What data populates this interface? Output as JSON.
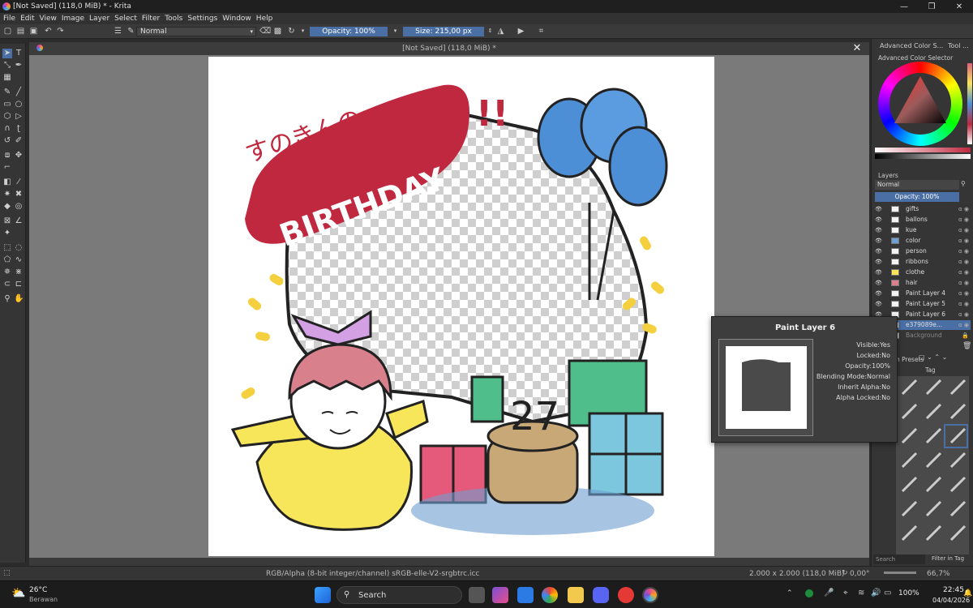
{
  "window": {
    "title": "[Not Saved]  (118,0 MiB) * - Krita",
    "minimize": "—",
    "maximize": "❐",
    "close": "✕"
  },
  "menu": [
    "File",
    "Edit",
    "View",
    "Image",
    "Layer",
    "Select",
    "Filter",
    "Tools",
    "Settings",
    "Window",
    "Help"
  ],
  "toolbar": {
    "blend_mode": "Normal",
    "opacity_label": "Opacity: 100%",
    "size_label": "Size: 215,00 px"
  },
  "document": {
    "tab_title": "[Not Saved]  (118,0 MiB) *",
    "close_glyph": "✕"
  },
  "artwork": {
    "text_top": "すのきんの",
    "text_banner": "BIRTHDAY",
    "exclaim": "!!",
    "cake_number": "27"
  },
  "docker": {
    "tab1": "Advanced Color S...",
    "tab2": "Tool ...",
    "color_selector_title": "Advanced Color Selector",
    "layers_title": "Layers",
    "blend_mode": "Normal",
    "opacity": "Opacity: 100%",
    "layers": [
      {
        "name": "gifts"
      },
      {
        "name": "ballons"
      },
      {
        "name": "kue"
      },
      {
        "name": "color"
      },
      {
        "name": "person"
      },
      {
        "name": "ribbons"
      },
      {
        "name": "clothe"
      },
      {
        "name": "hair"
      },
      {
        "name": "Paint Layer 4"
      },
      {
        "name": "Paint Layer 5"
      },
      {
        "name": "Paint Layer 6"
      },
      {
        "name": "e379089e..."
      },
      {
        "name": "Background"
      }
    ],
    "brush_presets_title": "h Presets",
    "tag_label": "Tag",
    "search_placeholder": "Search",
    "filter_in_tag": "Filter in Tag"
  },
  "tooltip": {
    "title": "Paint Layer 6",
    "visible": "Visible:Yes",
    "locked": "Locked:No",
    "opacity": "Opacity:100%",
    "blending": "Blending Mode:Normal",
    "inherit_alpha": "Inherit Alpha:No",
    "alpha_locked": "Alpha Locked:No"
  },
  "status": {
    "color_space": "RGB/Alpha (8-bit integer/channel)  sRGB-elle-V2-srgbtrc.icc",
    "dimensions": "2.000 x 2.000 (118,0 MiB)",
    "rotation": "0,00°",
    "zoom": "66,7%"
  },
  "taskbar": {
    "weather_temp": "26°C",
    "weather_desc": "Berawan",
    "search_label": "Search",
    "battery": "100%",
    "time": "22:45",
    "date": "04/04/2026"
  },
  "colors": {
    "accent": "#4a6fa5",
    "banner_red": "#c0283f",
    "balloon_blue": "#4d8fd6"
  }
}
